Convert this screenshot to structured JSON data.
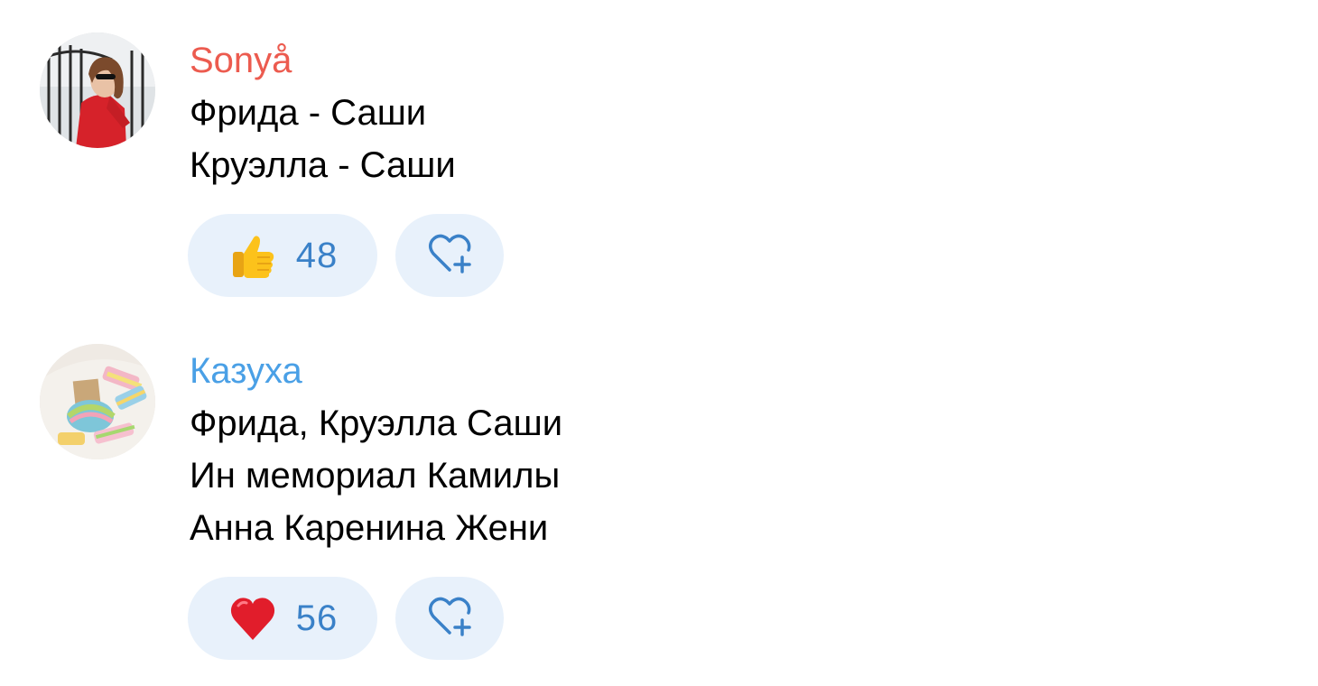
{
  "comments": [
    {
      "author": "Sonyå",
      "author_color": "#ec5b4f",
      "lines": [
        "Фрида - Саши",
        "Круэлла - Саши"
      ],
      "reaction": {
        "icon": "thumbs-up-icon",
        "count": "48"
      },
      "add_reaction_icon": "heart-plus-icon"
    },
    {
      "author": "Казуха",
      "author_color": "#4aa0e6",
      "lines": [
        "Фрида, Круэлла Саши",
        "Ин мемориал Камилы",
        "Анна Каренина Жени"
      ],
      "reaction": {
        "icon": "red-heart-icon",
        "count": "56"
      },
      "add_reaction_icon": "heart-plus-icon"
    }
  ],
  "colors": {
    "reaction_background": "#e8f1fb",
    "reaction_text": "#3a81c8"
  }
}
